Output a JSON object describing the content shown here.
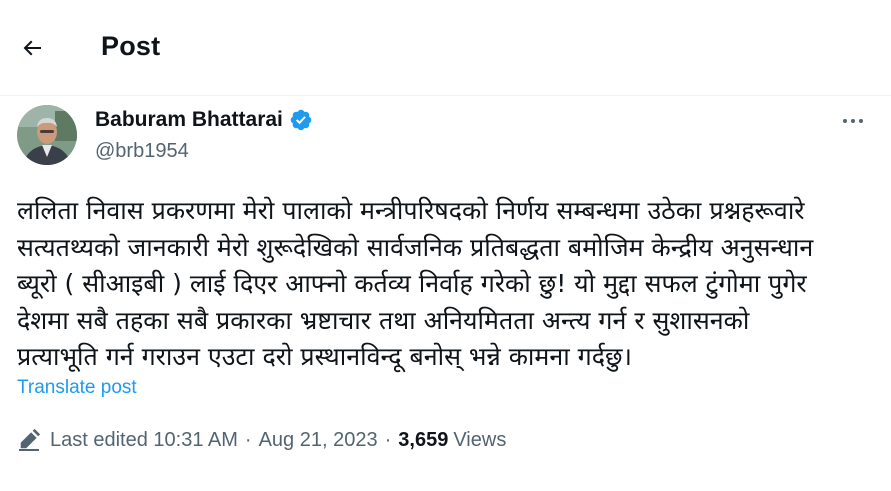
{
  "header": {
    "title": "Post",
    "back_icon": "arrow-left-icon"
  },
  "post": {
    "author_name": "Baburam Bhattarai",
    "handle": "@brb1954",
    "verified_icon": "verified-badge-icon",
    "verified_color": "#1d9bf0",
    "text": "ललिता निवास प्रकरणमा मेरो पालाको मन्त्रीपरिषदको निर्णय सम्बन्धमा उठेका प्रश्नहरूवारे\nसत्यतथ्यको जानकारी मेरो शुरूदेखिको सार्वजनिक प्रतिबद्धता बमोजिम केन्द्रीय अनुसन्धान\nब्यूरो ( सीआइबी ) लाई दिएर आफ्नो कर्तव्य निर्वाह गरेको छु! यो मुद्दा सफल टुंगोमा पुगेर\nदेशमा सबै तहका सबै प्रकारका भ्रष्टाचार तथा अनियमितता अन्त्य गर्न र सुशासनको\nप्रत्याभूति गर्न गराउन एउटा दरो प्रस्थानविन्दू बनोस् भन्ने कामना गर्दछु।",
    "translate_label": "Translate post",
    "edited_label": "Last edited 10:31 AM",
    "separator": "·",
    "date": "Aug 21, 2023",
    "views_count": "3,659",
    "views_label": "Views"
  }
}
